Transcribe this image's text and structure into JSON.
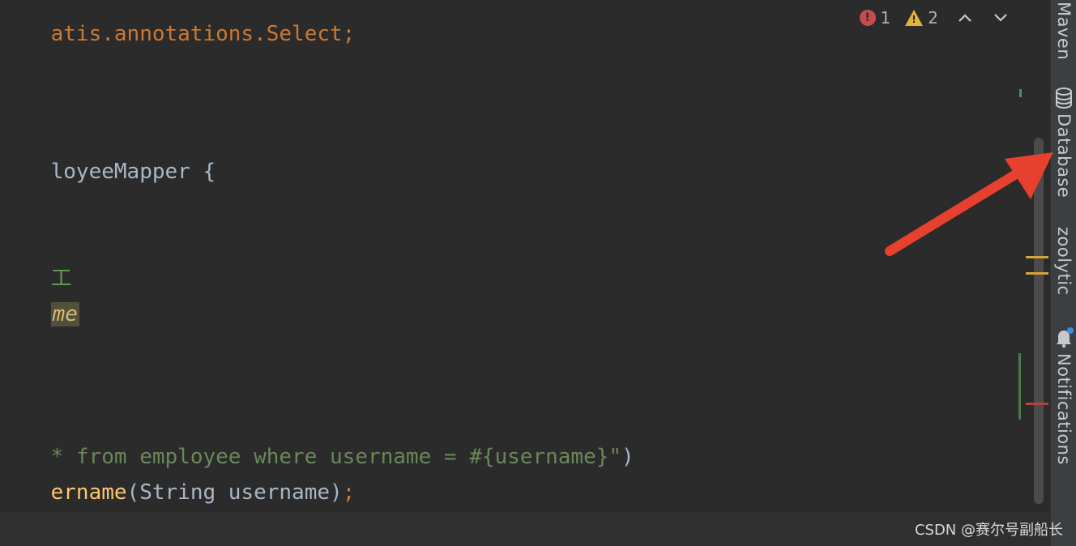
{
  "editor": {
    "line1": {
      "text": "atis.annotations.Select;"
    },
    "line2": {
      "text": "loyeeMapper {"
    },
    "line3": {
      "text": "工"
    },
    "line4": {
      "text": "me"
    },
    "line5": {
      "star": "* ",
      "string": "from employee where username = #{username}\"",
      "close": ")"
    },
    "line6": {
      "method": "ername",
      "args": "(String username)",
      "semi": ";"
    }
  },
  "inspections": {
    "errors": "1",
    "warnings": "2",
    "icons": [
      "error-icon",
      "warning-icon",
      "chevron-up-icon",
      "chevron-down-icon"
    ]
  },
  "tool_strip": {
    "items": [
      {
        "label": "Maven"
      },
      {
        "label": "Database",
        "icon": "database-icon"
      },
      {
        "label": "zoolytic"
      },
      {
        "label": "Notifications",
        "icon": "bell-icon"
      }
    ]
  },
  "watermark": "CSDN @赛尔号副船长",
  "colors": {
    "editor_bg": "#2b2b2b",
    "strip_bg": "#3c3f41",
    "keyword": "#cc7832",
    "string": "#6a8759",
    "method": "#ffc66d",
    "arrow": "#e8402e"
  }
}
